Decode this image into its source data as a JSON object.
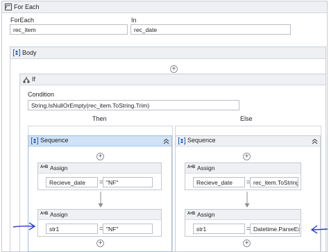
{
  "foreach": {
    "title": "For Each",
    "foreach_label": "ForEach",
    "foreach_value": "rec_item",
    "in_label": "In",
    "in_value": "rec_date"
  },
  "body": {
    "title": "Body"
  },
  "if_block": {
    "title": "If",
    "condition_label": "Condition",
    "condition_value": "String.IsNullOrEmpty(rec_item.ToString.Trim)",
    "then_label": "Then",
    "else_label": "Else"
  },
  "then_sequence": {
    "title": "Sequence",
    "assign1": {
      "title": "Assign",
      "to": "Recieve_date",
      "value": "\"NF\""
    },
    "assign2": {
      "title": "Assign",
      "to": "str1",
      "value": "\"NF\""
    }
  },
  "else_sequence": {
    "title": "Sequence",
    "assign1": {
      "title": "Assign",
      "to": "Recieve_date",
      "value": "rec_item.ToString"
    },
    "assign2": {
      "title": "Assign",
      "to": "str1",
      "value": "Datetime.ParseExa"
    }
  },
  "symbols": {
    "equals": "=",
    "assign_icon": "A+B",
    "plus": "+"
  },
  "colors": {
    "sequence_header_active": "#cfe2f6",
    "accent_blue": "#1f5fc9",
    "arrow_annotation": "#2a3bc4"
  }
}
